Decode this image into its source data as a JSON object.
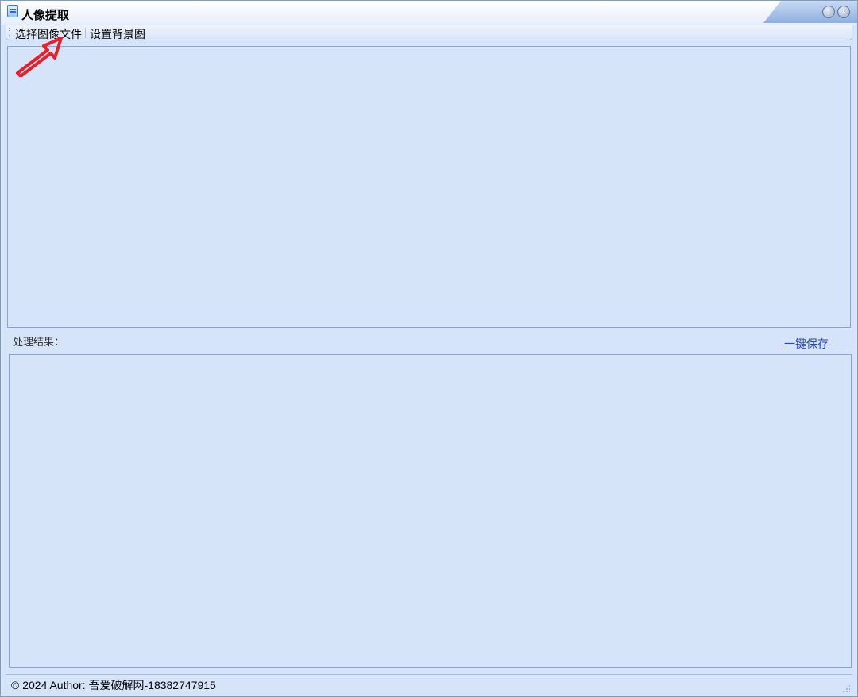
{
  "window": {
    "title": "人像提取",
    "app_icon": "app-icon",
    "controls": {
      "minimize_icon": "minimize-icon",
      "minimize_glyph": "–",
      "close_icon": "close-icon",
      "close_glyph": "×"
    }
  },
  "toolbar": {
    "items": [
      {
        "label": "选择图像文件"
      },
      {
        "label": "设置背景图"
      }
    ]
  },
  "main": {
    "result_label": "处理结果：",
    "save_link": "一键保存"
  },
  "statusbar": {
    "text": "© 2024 Author: 吾爱破解网-18382747915"
  },
  "annotation": {
    "icon": "red-arrow-icon",
    "color": "#e8202a"
  },
  "colors": {
    "background": "#d6e4fa",
    "panel_border": "#8aa4cf",
    "link": "#2b44d6"
  }
}
